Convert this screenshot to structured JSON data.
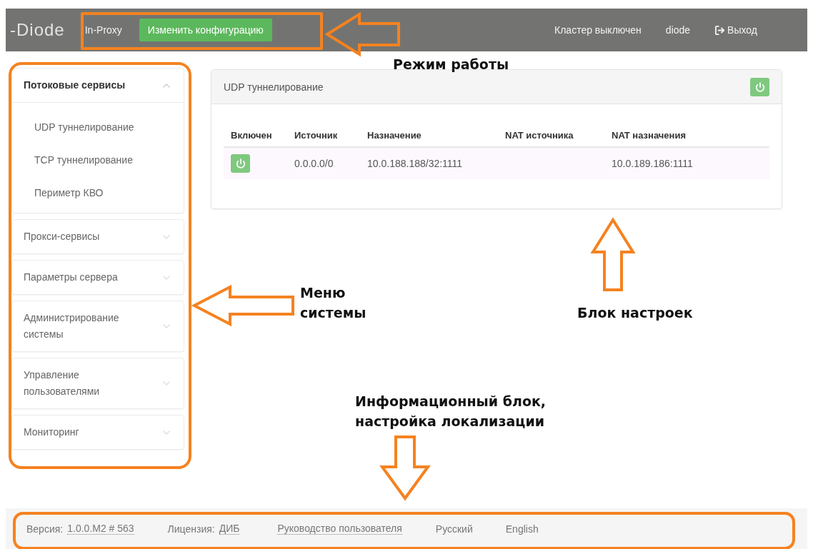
{
  "topbar": {
    "brand": "-Diode",
    "mode": "In-Proxy",
    "change_config_button": "Изменить конфигурацию",
    "cluster_status": "Кластер выключен",
    "user": "diode",
    "logout": "Выход"
  },
  "sidebar": {
    "sections": [
      {
        "title": "Потоковые сервисы",
        "expanded": true,
        "items": [
          "UDP туннелирование",
          "TCP туннелирование",
          "Периметр КВО"
        ]
      },
      {
        "title": "Прокси-сервисы",
        "expanded": false
      },
      {
        "title": "Параметры сервера",
        "expanded": false
      },
      {
        "title": "Администрирование системы",
        "expanded": false
      },
      {
        "title": "Управление пользователями",
        "expanded": false
      },
      {
        "title": "Мониторинг",
        "expanded": false
      }
    ]
  },
  "panel": {
    "title": "UDP туннелирование",
    "on": true,
    "table": {
      "columns": [
        "Включен",
        "Источник",
        "Назначение",
        "NAT источника",
        "NAT назначения"
      ],
      "rows": [
        {
          "on": true,
          "source": "0.0.0.0/0",
          "destination": "10.0.188.188/32:1111",
          "nat_destination": "10.0.189.186:1111"
        }
      ]
    }
  },
  "footer": {
    "version_label": "Версия:",
    "version": "1.0.0.M2 # 563",
    "license_label": "Лицензия:",
    "license": "ДИБ",
    "guide": "Руководство пользователя",
    "languages": [
      "Русский",
      "English"
    ]
  },
  "annotations": [
    {
      "label": "Режим работы"
    },
    {
      "label": "Меню системы"
    },
    {
      "label": "Блок настроек"
    },
    {
      "label": "Информационный блок, настройка локализации"
    }
  ]
}
